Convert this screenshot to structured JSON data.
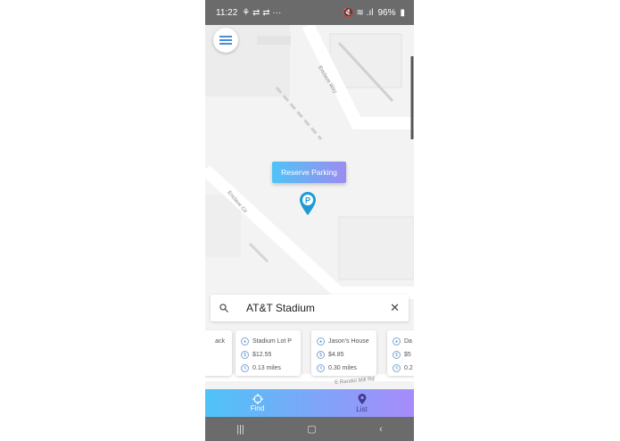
{
  "status": {
    "time": "11:22",
    "left_icons": "⚘ ⇄ ⇄ ···",
    "battery": "96%",
    "right_icons": "🔇 ≋ .ıl"
  },
  "map": {
    "roads": [
      "Enclave Way",
      "Enclave Cir",
      "E Randol Mill Rd"
    ]
  },
  "reserve_button": "Reserve Parking",
  "search": {
    "query": "AT&T Stadium"
  },
  "cards": [
    {
      "name": "ack",
      "price": "",
      "distance": ""
    },
    {
      "name": "Stadium Lot P",
      "price": "$12.55",
      "distance": "0.13 miles"
    },
    {
      "name": "Jason's House",
      "price": "$4.85",
      "distance": "0.30 miles"
    },
    {
      "name": "Da",
      "price": "$5",
      "distance": "0.2"
    }
  ],
  "nav": {
    "find": "Find",
    "list": "List"
  },
  "colors": {
    "gradient_start": "#4fc3f7",
    "gradient_end": "#a78bfa",
    "pin": "#1e9ad6"
  }
}
